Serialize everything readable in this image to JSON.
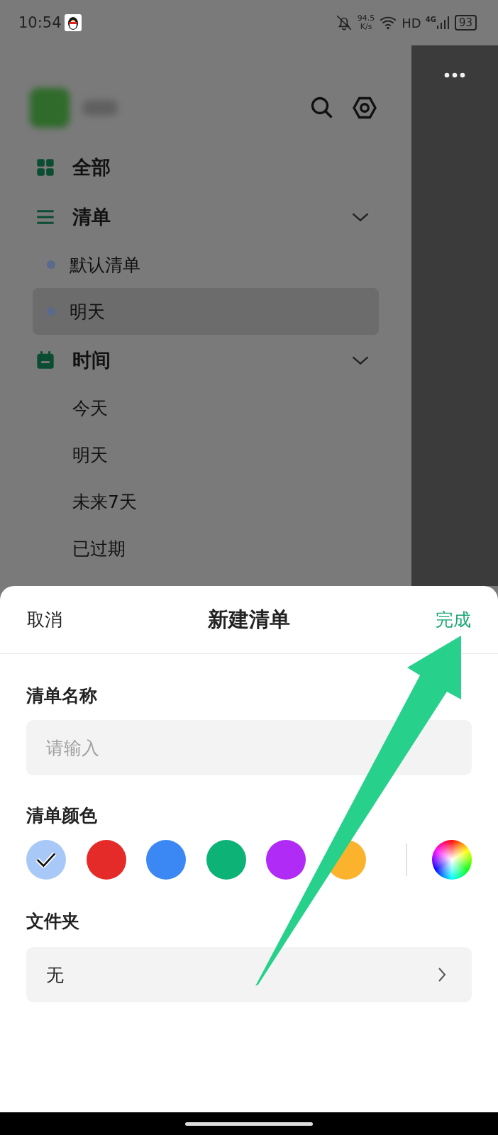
{
  "status_bar": {
    "time": "10:54",
    "net_speed": "94.5",
    "net_unit": "K/s",
    "network": "HD",
    "cellular": "4G",
    "battery": "93"
  },
  "sidebar": {
    "sections": [
      {
        "kind": "link",
        "label": "全部"
      },
      {
        "kind": "group",
        "label": "清单",
        "expanded": true,
        "items": [
          {
            "kind": "list",
            "label": "默认清单",
            "selected": false
          },
          {
            "kind": "list",
            "label": "明天",
            "selected": true
          }
        ]
      },
      {
        "kind": "group",
        "label": "时间",
        "expanded": true,
        "items": [
          {
            "kind": "filter",
            "label": "今天",
            "selected": false
          },
          {
            "kind": "filter",
            "label": "明天",
            "selected": false
          },
          {
            "kind": "filter",
            "label": "未来7天",
            "selected": false
          },
          {
            "kind": "filter",
            "label": "已过期",
            "selected": false
          }
        ]
      }
    ]
  },
  "sheet": {
    "cancel": "取消",
    "title": "新建清单",
    "done": "完成",
    "name_label": "清单名称",
    "name_placeholder": "请输入",
    "color_label": "清单颜色",
    "colors": [
      {
        "color": "#a8c8f8",
        "selected": true
      },
      {
        "color": "#e52a2a",
        "selected": false
      },
      {
        "color": "#3b88f5",
        "selected": false
      },
      {
        "color": "#0db277",
        "selected": false
      },
      {
        "color": "#b02cf6",
        "selected": false
      },
      {
        "color": "#fbb22c",
        "selected": false
      }
    ],
    "folder_label": "文件夹",
    "folder_value": "无"
  }
}
